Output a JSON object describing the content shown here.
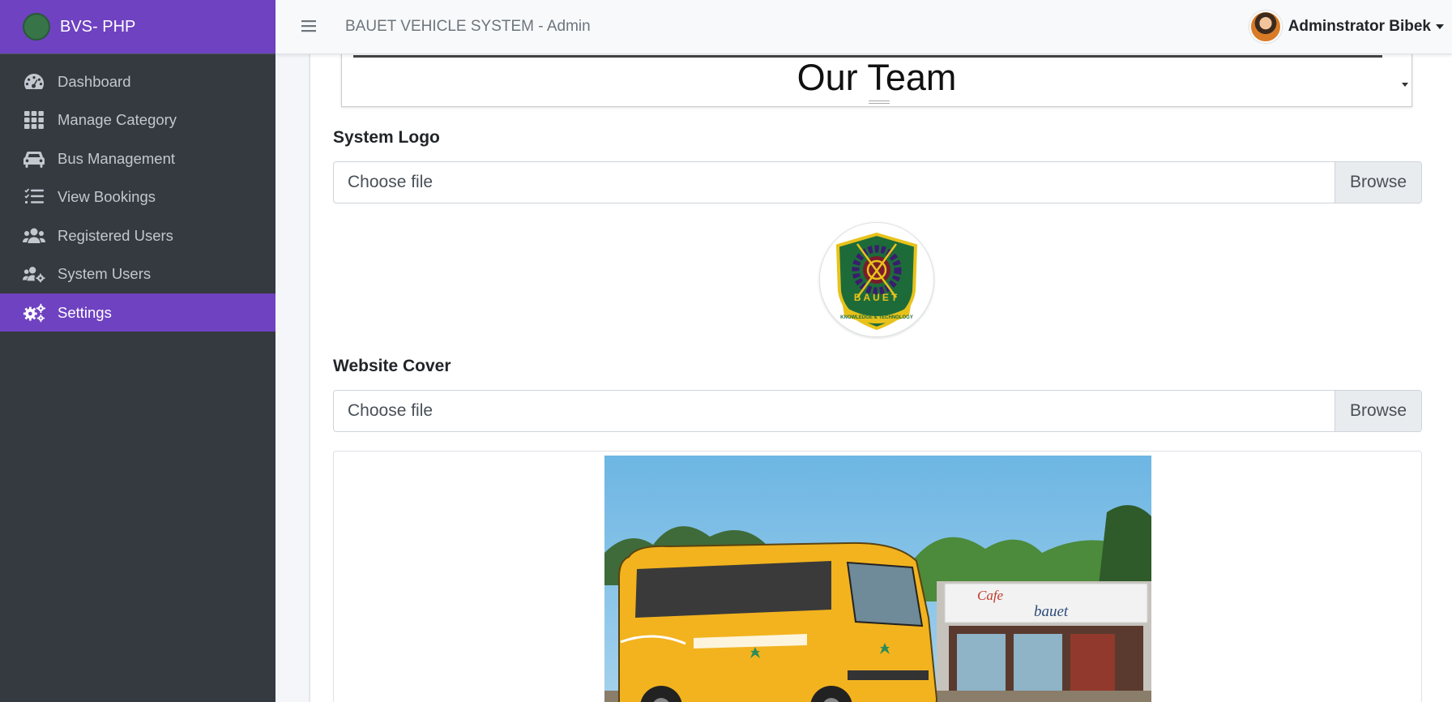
{
  "brand": {
    "name": "BVS- PHP"
  },
  "sidebar": {
    "items": [
      {
        "label": "Dashboard",
        "icon": "dashboard-icon"
      },
      {
        "label": "Manage Category",
        "icon": "grid-icon"
      },
      {
        "label": "Bus Management",
        "icon": "car-icon"
      },
      {
        "label": "View Bookings",
        "icon": "list-check-icon"
      },
      {
        "label": "Registered Users",
        "icon": "users-icon"
      },
      {
        "label": "System Users",
        "icon": "users-cog-icon"
      },
      {
        "label": "Settings",
        "icon": "cogs-icon",
        "active": true
      }
    ]
  },
  "header": {
    "menu_icon": "hamburger-icon",
    "title": "BAUET VEHICLE SYSTEM - Admin",
    "user_name": "Adminstrator Bibek"
  },
  "editor": {
    "text": "Our Team"
  },
  "system_logo": {
    "label": "System Logo",
    "placeholder": "Choose file",
    "browse": "Browse",
    "logo_text": "BAUET",
    "logo_motto": "KNOWLEDGE & TECHNOLOGY"
  },
  "website_cover": {
    "label": "Website Cover",
    "placeholder": "Choose file",
    "browse": "Browse",
    "sign_cafe": "Cafe",
    "sign_name": "bauet"
  },
  "colors": {
    "brand_purple": "#6f42c1",
    "sidebar_dark": "#343a40",
    "logo_green": "#1e6b3a"
  }
}
